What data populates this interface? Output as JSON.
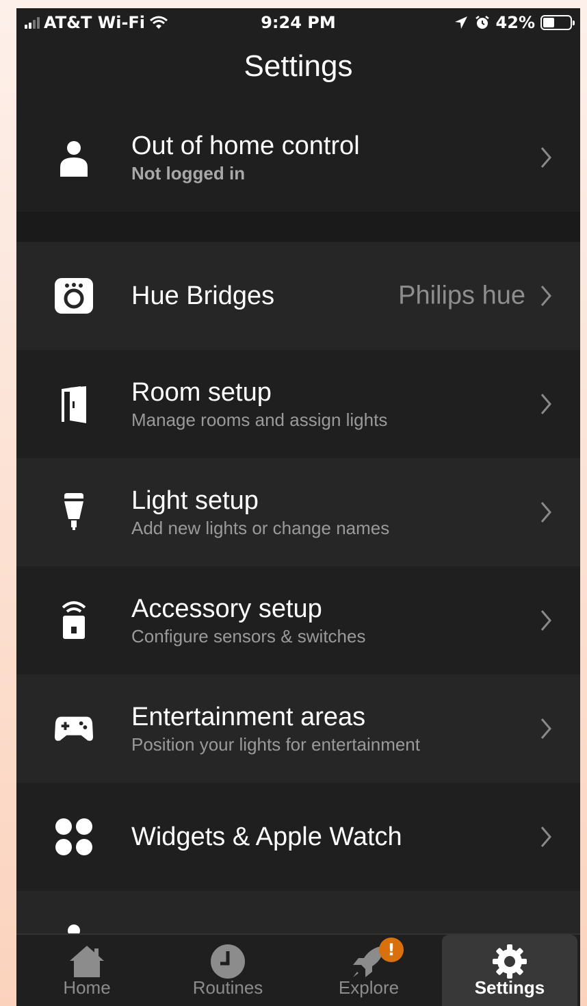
{
  "status_bar": {
    "carrier": "AT&T Wi-Fi",
    "time": "9:24 PM",
    "battery": "42%",
    "battery_level": 0.42
  },
  "page_title": "Settings",
  "rows": [
    {
      "label": "Out of home control",
      "sub": "Not logged in",
      "icon": "person-icon"
    },
    {
      "label": "Hue Bridges",
      "value": "Philips hue",
      "icon": "bridge-icon"
    },
    {
      "label": "Room setup",
      "sub": "Manage rooms and assign lights",
      "icon": "door-icon"
    },
    {
      "label": "Light setup",
      "sub": "Add new lights or change names",
      "icon": "bulb-icon"
    },
    {
      "label": "Accessory setup",
      "sub": "Configure sensors & switches",
      "icon": "accessory-icon"
    },
    {
      "label": "Entertainment areas",
      "sub": "Position your lights for entertainment",
      "icon": "gamepad-icon"
    },
    {
      "label": "Widgets & Apple Watch",
      "icon": "widgets-icon"
    }
  ],
  "tabs": [
    {
      "label": "Home",
      "icon": "home-icon"
    },
    {
      "label": "Routines",
      "icon": "clock-icon"
    },
    {
      "label": "Explore",
      "icon": "rocket-icon",
      "badge": "!"
    },
    {
      "label": "Settings",
      "icon": "gear-icon",
      "active": true
    }
  ],
  "colors": {
    "background": "#1f1f1f",
    "row_alt": "#262626",
    "badge": "#d9700e"
  }
}
